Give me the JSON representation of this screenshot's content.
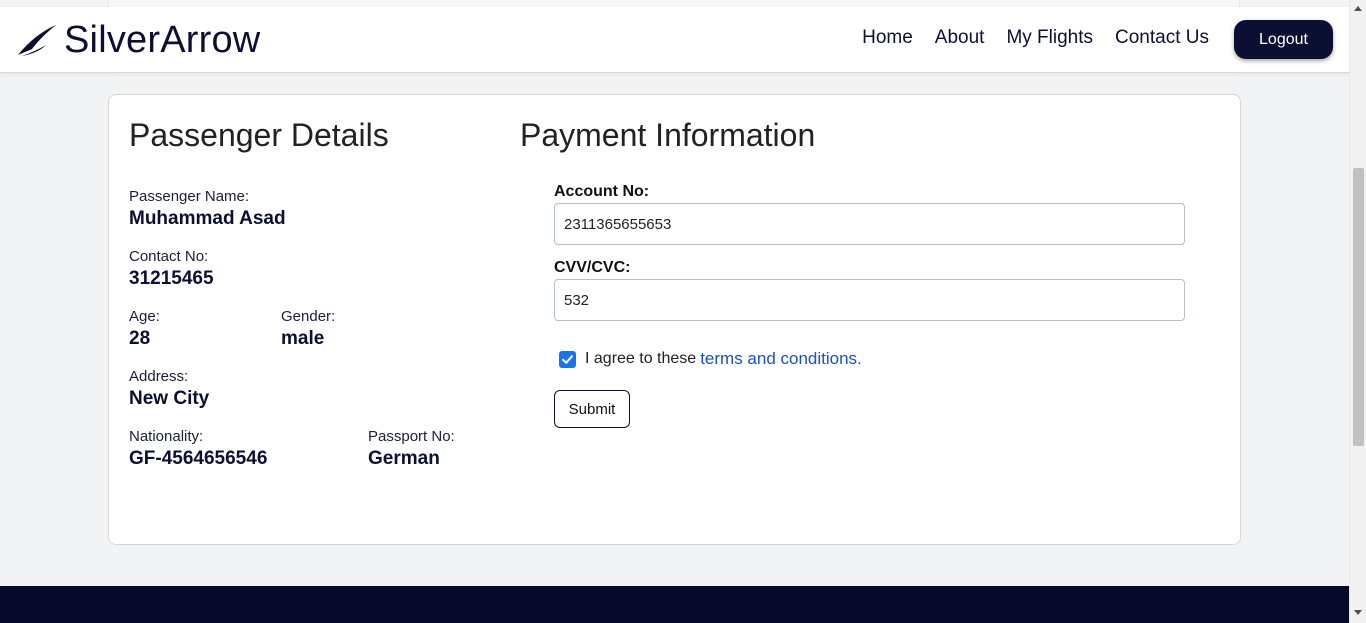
{
  "navbar": {
    "brand": "SilverArrow",
    "links": [
      "Home",
      "About",
      "My Flights",
      "Contact Us"
    ],
    "logout_label": "Logout"
  },
  "passenger": {
    "title": "Passenger Details",
    "name_label": "Passenger Name:",
    "name_value": "Muhammad Asad",
    "contact_label": "Contact No:",
    "contact_value": "31215465",
    "age_label": "Age:",
    "age_value": "28",
    "gender_label": "Gender:",
    "gender_value": "male",
    "address_label": "Address:",
    "address_value": "New City",
    "nationality_label": "Nationality:",
    "nationality_value": "GF-4564656546",
    "passport_label": "Passport No:",
    "passport_value": "German"
  },
  "payment": {
    "title": "Payment Information",
    "account_label": "Account No:",
    "account_value": "2311365655653",
    "cvv_label": "CVV/CVC:",
    "cvv_value": "532",
    "agree_text": "I agree to these",
    "terms_link": "terms and conditions.",
    "agree_checked": true,
    "submit_label": "Submit"
  },
  "colors": {
    "brand_navy": "#0b1033",
    "checkbox_blue": "#1a73e8",
    "link_blue": "#1d4fc4",
    "footer": "#06082a"
  }
}
